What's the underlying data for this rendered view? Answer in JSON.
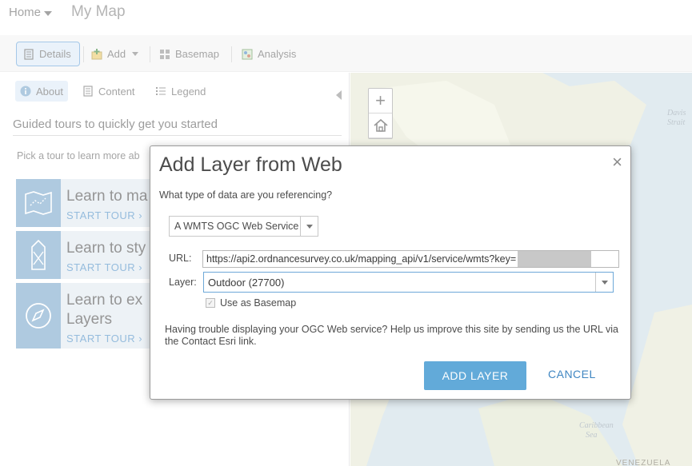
{
  "header": {
    "home_label": "Home",
    "map_title": "My Map"
  },
  "toolbar": {
    "details_label": "Details",
    "add_label": "Add",
    "basemap_label": "Basemap",
    "analysis_label": "Analysis"
  },
  "panel": {
    "tabs": [
      {
        "label": "About",
        "icon": "info-icon"
      },
      {
        "label": "Content",
        "icon": "content-icon"
      },
      {
        "label": "Legend",
        "icon": "legend-icon"
      }
    ],
    "guided_title": "Guided tours to quickly get you started",
    "pick_text": "Pick a tour to learn more ab",
    "tours": [
      {
        "title": "Learn to ma",
        "link": "START TOUR ›",
        "icon": "map-tour-icon"
      },
      {
        "title": "Learn to sty",
        "link": "START TOUR ›",
        "icon": "style-tour-icon"
      },
      {
        "title": "Learn to ex",
        "title2": "Layers",
        "link": "START TOUR ›",
        "icon": "compass-tour-icon"
      }
    ]
  },
  "map": {
    "zoom_in": "+",
    "labels": {
      "davis": "Davis",
      "strait": "Strait",
      "caribbean": "Caribbean",
      "sea": "Sea",
      "venezuela": "VENEZUELA"
    }
  },
  "dialog": {
    "title": "Add Layer from Web",
    "close": "×",
    "question": "What type of data are you referencing?",
    "type_value": "A WMTS OGC Web Service",
    "url_label": "URL:",
    "url_value": "https://api2.ordnancesurvey.co.uk/mapping_api/v1/service/wmts?key=",
    "layer_label": "Layer:",
    "layer_value": "Outdoor (27700)",
    "basemap_checkbox_label": "Use as Basemap",
    "basemap_checked": true,
    "help_text": "Having trouble displaying your OGC Web service? Help us improve this site by sending us the URL via the Contact Esri link.",
    "add_button": "ADD LAYER",
    "cancel_button": "CANCEL"
  },
  "colors": {
    "accent": "#62aad9",
    "link": "#3f86c2",
    "tour_icon_bg": "#6e9fc6",
    "active_tab_bg": "#d9e8f6"
  }
}
